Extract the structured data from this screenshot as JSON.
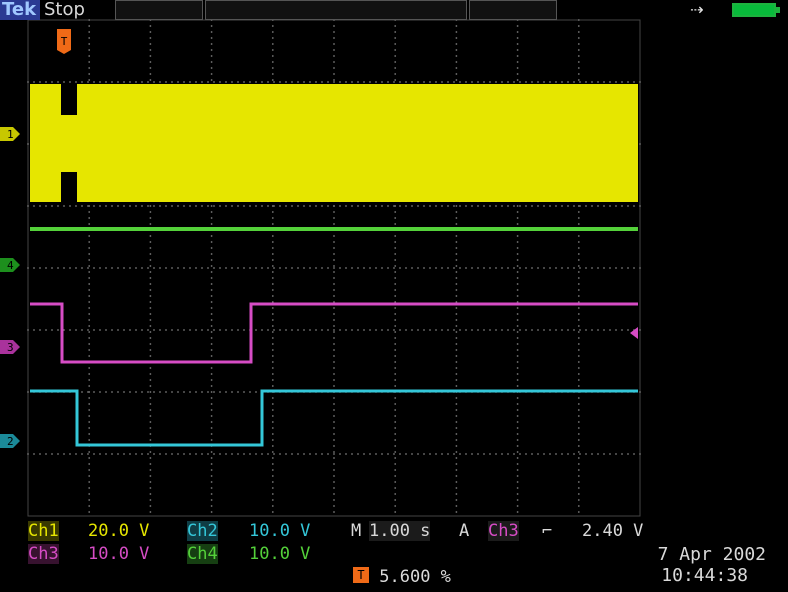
{
  "header": {
    "brand": "Tek",
    "state": "Stop"
  },
  "trigger": {
    "marker_label": "T",
    "readout": "5.600 %"
  },
  "channels": {
    "ch1": {
      "label": "Ch1",
      "value": "20.0 V",
      "color": "#e6e600"
    },
    "ch2": {
      "label": "Ch2",
      "value": "10.0 V",
      "color": "#34c7d9"
    },
    "ch3": {
      "label": "Ch3",
      "value": "10.0 V",
      "color": "#d64cc5"
    },
    "ch4": {
      "label": "Ch4",
      "value": "10.0 V",
      "color": "#54d13a"
    }
  },
  "timebase": {
    "label": "M",
    "value": "1.00 s"
  },
  "trigger_settings": {
    "mode": "A",
    "source": "Ch3",
    "slope_symbol": "⌐",
    "level": "2.40 V"
  },
  "timestamp": {
    "date": "7 Apr 2002",
    "time": "10:44:38"
  },
  "markers": {
    "ch1": "1",
    "ch2": "2",
    "ch3": "3",
    "ch4": "4"
  },
  "colors": {
    "grid": "#777777",
    "trigger": "#ef6a17",
    "battery": "#08bb3b"
  }
}
